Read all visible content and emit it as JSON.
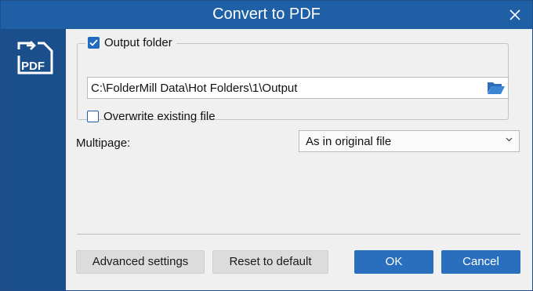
{
  "window": {
    "title": "Convert to PDF"
  },
  "sidebar": {
    "icon": "pdf-convert-icon"
  },
  "output": {
    "checkbox_label": "Output folder",
    "checked": true,
    "path_value": "C:\\FolderMill Data\\Hot Folders\\1\\Output",
    "overwrite_label": "Overwrite existing file",
    "overwrite_checked": false
  },
  "multipage": {
    "label": "Multipage:",
    "selected": "As in original file"
  },
  "buttons": {
    "advanced": "Advanced settings",
    "reset": "Reset to default",
    "ok": "OK",
    "cancel": "Cancel"
  },
  "colors": {
    "titlebar": "#1f5fa6",
    "sidebar": "#1a4f8c",
    "primary_button": "#2a6fbd"
  }
}
